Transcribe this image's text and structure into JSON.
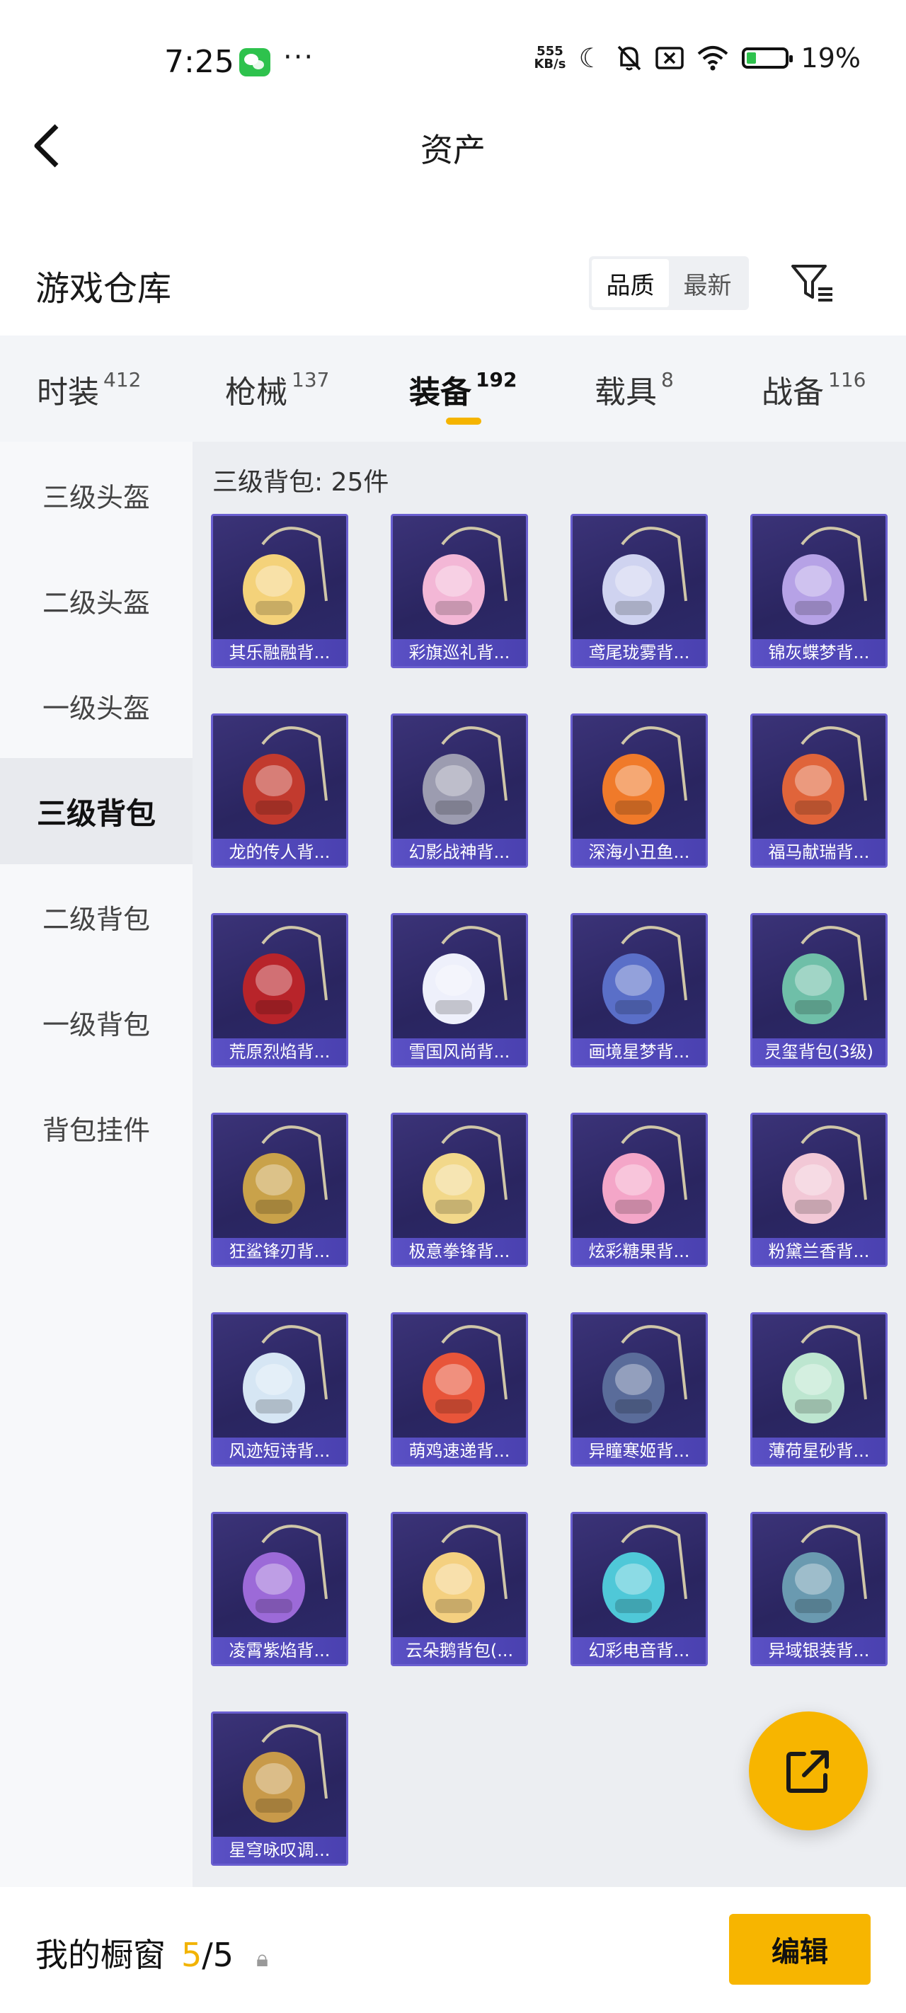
{
  "status_bar": {
    "time": "7:25",
    "network_speed_value": "555",
    "network_speed_unit": "KB/s",
    "battery": "19%"
  },
  "header": {
    "title": "资产"
  },
  "section": {
    "title": "游戏仓库",
    "sort_options": [
      "品质",
      "最新"
    ],
    "sort_selected": "品质"
  },
  "tabs": [
    {
      "label": "时装",
      "count": "412"
    },
    {
      "label": "枪械",
      "count": "137"
    },
    {
      "label": "装备",
      "count": "192",
      "active": true
    },
    {
      "label": "载具",
      "count": "8"
    },
    {
      "label": "战备",
      "count": "116"
    }
  ],
  "sidebar": {
    "items": [
      "三级头盔",
      "二级头盔",
      "一级头盔",
      "三级背包",
      "二级背包",
      "一级背包",
      "背包挂件"
    ],
    "selected": "三级背包"
  },
  "content": {
    "count_label": "三级背包: 25件",
    "items": [
      {
        "name": "其乐融融背...",
        "accent": "#f4d27a"
      },
      {
        "name": "彩旗巡礼背...",
        "accent": "#f3b7d6"
      },
      {
        "name": "鸢尾珑雾背...",
        "accent": "#cfd3f0"
      },
      {
        "name": "锦灰蝶梦背...",
        "accent": "#b6a2e6"
      },
      {
        "name": "龙的传人背...",
        "accent": "#c23a2e"
      },
      {
        "name": "幻影战神背...",
        "accent": "#9c9cb0"
      },
      {
        "name": "深海小丑鱼...",
        "accent": "#f07a2a"
      },
      {
        "name": "福马献瑞背...",
        "accent": "#e0643a"
      },
      {
        "name": "荒原烈焰背...",
        "accent": "#b8242a"
      },
      {
        "name": "雪国风尚背...",
        "accent": "#eef0fb"
      },
      {
        "name": "画境星梦背...",
        "accent": "#5a6fc8"
      },
      {
        "name": "灵玺背包(3级)",
        "accent": "#6fbfa8"
      },
      {
        "name": "狂鲨锋刃背...",
        "accent": "#c9a24a"
      },
      {
        "name": "极意拳锋背...",
        "accent": "#f2d88a"
      },
      {
        "name": "炫彩糖果背...",
        "accent": "#f4a6c8"
      },
      {
        "name": "粉黛兰香背...",
        "accent": "#f2c8d6"
      },
      {
        "name": "风迹短诗背...",
        "accent": "#d6e6f4"
      },
      {
        "name": "萌鸡速递背...",
        "accent": "#e8553a"
      },
      {
        "name": "异瞳寒姬背...",
        "accent": "#5a6c9a"
      },
      {
        "name": "薄荷星砂背...",
        "accent": "#bde6d0"
      },
      {
        "name": "凌霄紫焰背...",
        "accent": "#9c6ad8"
      },
      {
        "name": "云朵鹅背包(...",
        "accent": "#f4d080"
      },
      {
        "name": "幻彩电音背...",
        "accent": "#4fc8d8"
      },
      {
        "name": "异域银装背...",
        "accent": "#6a9ab0"
      },
      {
        "name": "星穹咏叹调...",
        "accent": "#c89a4a"
      }
    ]
  },
  "bottom_bar": {
    "label": "我的橱窗",
    "used": "5",
    "total": "/5",
    "edit_label": "编辑"
  }
}
